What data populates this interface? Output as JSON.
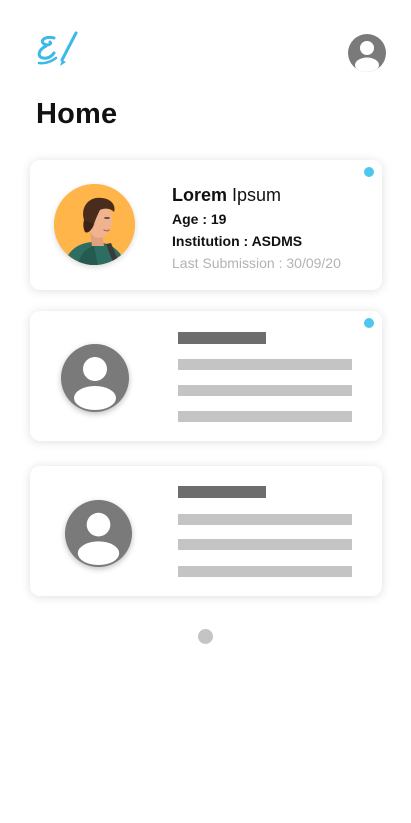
{
  "header": {
    "logo_icon": "signature-logo",
    "profile_icon": "account-circle-icon",
    "title": "Home"
  },
  "cards": [
    {
      "name_first": "Lorem",
      "name_last": "Ipsum",
      "age": "Age : 19",
      "institution": "Institution : ASDMS",
      "last_submission": "Last Submission : 30/09/20",
      "unread": true,
      "avatar": "user-photo"
    },
    {
      "placeholder": true,
      "unread": true,
      "avatar": "account-circle-icon"
    },
    {
      "placeholder": true,
      "unread": false,
      "avatar": "account-circle-icon"
    }
  ],
  "colors": {
    "accent_dot": "#4ec7ef",
    "logo_blue": "#3bb9e8",
    "avatar_bg": "#ffb54a",
    "placeholder_dark": "#6d6d6d",
    "placeholder_light": "#c4c4c4"
  },
  "pagination": {
    "pages": 1,
    "current": 1
  }
}
